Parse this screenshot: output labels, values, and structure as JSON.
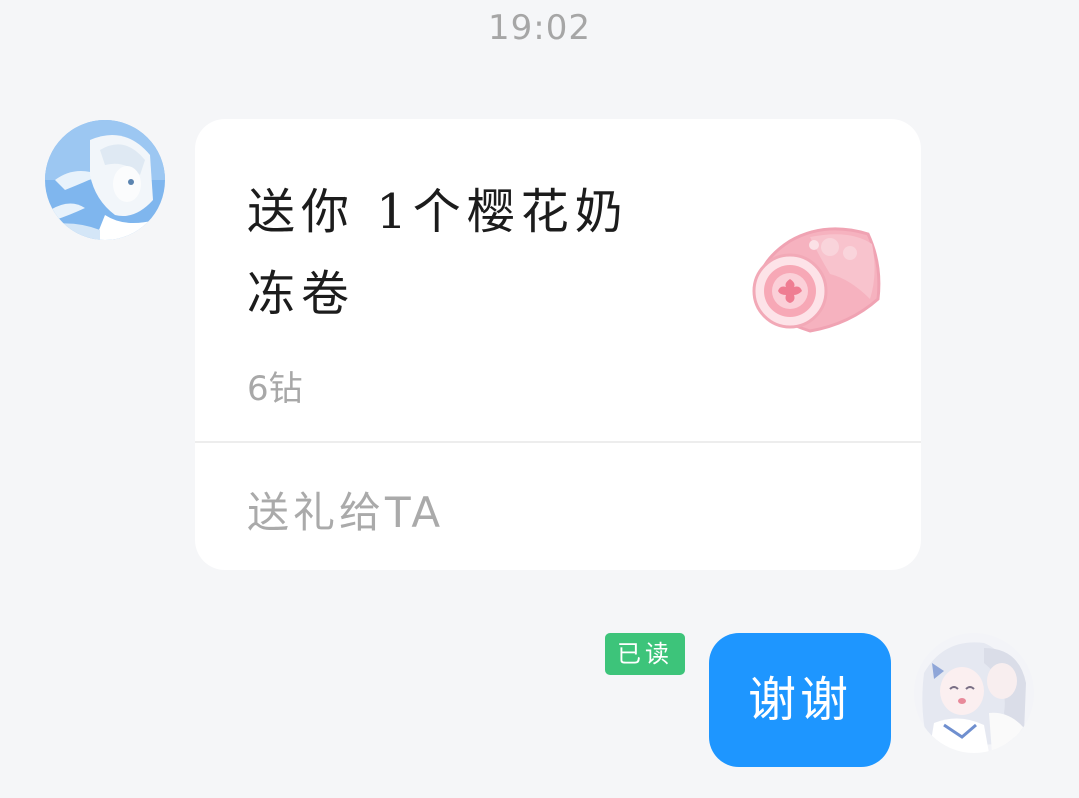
{
  "chat": {
    "timestamp": "19:02",
    "incoming": {
      "avatar_icon": "user-avatar-icon",
      "gift_card": {
        "title": "送你 1个樱花奶冻卷",
        "price": "6钻",
        "gift_icon": "sakura-roll-cake-icon",
        "action_label": "送礼给TA"
      }
    },
    "outgoing": {
      "read_status": "已读",
      "message": "谢谢",
      "avatar_icon": "self-avatar-icon"
    }
  },
  "colors": {
    "background": "#f5f6f8",
    "bubble_outgoing": "#1e96ff",
    "read_badge": "#3dc47a",
    "card": "#ffffff"
  }
}
